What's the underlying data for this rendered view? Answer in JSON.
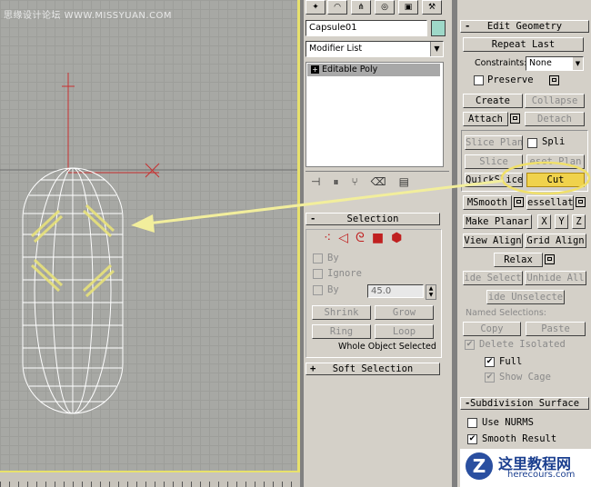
{
  "watermark": "思缘设计论坛 WWW.MISSYUAN.COM",
  "site_logo": {
    "title": "这里教程网",
    "url": "herecours.com"
  },
  "object": {
    "name": "Capsule01",
    "color": "#9ed8c8"
  },
  "modifier": {
    "dropdown_value": "Modifier List",
    "stack": [
      "Editable Poly"
    ]
  },
  "selection": {
    "title": "Selection",
    "by_vertex": "By",
    "ignore_backfacing": "Ignore",
    "by_angle": "By",
    "angle_value": "45.0",
    "shrink": "Shrink",
    "grow": "Grow",
    "ring": "Ring",
    "loop": "Loop",
    "status": "Whole Object Selected"
  },
  "soft_selection": {
    "title": "Soft Selection"
  },
  "edit_geometry": {
    "title": "Edit Geometry",
    "repeat_last": "Repeat Last",
    "constraints_label": "Constraints:",
    "constraints_value": "None",
    "preserve": "Preserve",
    "create": "Create",
    "collapse": "Collapse",
    "attach": "Attach",
    "detach": "Detach",
    "slice_plane": "Slice Plan",
    "split": "Spli",
    "slice": "Slice",
    "reset_plane": "eset Plan",
    "quickslice": "QuickSlice",
    "cut": "Cut",
    "msmooth": "MSmooth",
    "tessellate": "essellat",
    "make_planar": "Make Planar",
    "x": "X",
    "y": "Y",
    "z": "Z",
    "view_align": "View Align",
    "grid_align": "Grid Align",
    "relax": "Relax",
    "hide_selected": "ide Select",
    "unhide_all": "Unhide All",
    "hide_unselected": "ide Unselecte",
    "named_selections": "Named Selections:",
    "copy": "Copy",
    "paste": "Paste",
    "delete_isolated": "Delete Isolated",
    "full": "Full",
    "show_cage": "Show Cage"
  },
  "subdivision": {
    "title": "Subdivision Surface",
    "use_nurms": "Use NURMS",
    "smooth_result": "Smooth Result"
  },
  "colors": {
    "highlight": "#f0d24c",
    "annotation": "#f2ee9c",
    "viewport": "#a7a8a4"
  }
}
